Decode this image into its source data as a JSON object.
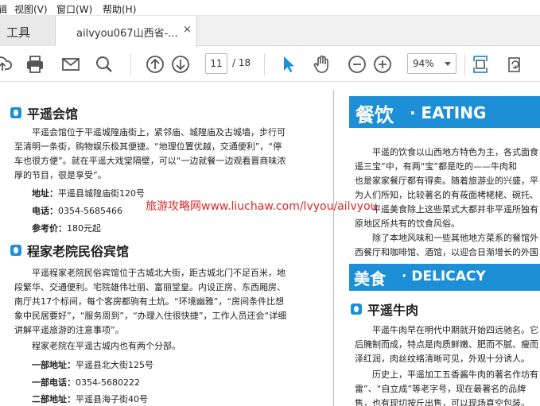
{
  "menu": {
    "partial": "辑",
    "items": [
      "视图(V)",
      "窗口(W)",
      "帮助(H)"
    ]
  },
  "tabs": {
    "tools_label": "工具",
    "doc_title": "ailvyou067山西省-...",
    "close_symbol": "×"
  },
  "toolbar": {
    "page_current": "11",
    "page_total": "/ 18",
    "zoom": "94%",
    "accent": "#1c8fd6"
  },
  "left": {
    "s1_title": "平遥会馆",
    "s1_p1": "平遥会馆位于平遥城隍庙街上，紧邻庙、城隍庙及古城墙，步行可至清明一条街，购物娱乐极其便捷。“地理位置优越，交通便利”，“停车也很方便”。就在平遥大戏堂隔壁，可以“一边就餐一边观看晋商味浓厚的节目，很是享受”。",
    "s1_addr_label": "地址：",
    "s1_addr": "平遥县城隍庙街120号",
    "s1_tel_label": "电话：",
    "s1_tel": "0354-5685466",
    "s1_price_label": "参考价：",
    "s1_price": "180元起",
    "s2_title": "程家老院民俗宾馆",
    "s2_p1": "平遥程家老院民俗宾馆位于古城北大街，距古城北门不足百米，地段繁华、交通便利。宅院雄伟壮丽、富丽堂皇。内设正房、东西厢房、南厅共17个标间，每个客房都驹有土炕。“环境幽雅”，“房间条件比想象中民居要好”，“服务周到”，“办理入住很快捷”，工作人员还会“详细讲解平遥旅游的注意事项”。",
    "s2_p2": "程家老院在平遥古城内也有两个分部。",
    "s2_a1_label": "一部地址：",
    "s2_a1": "平遥县北大街125号",
    "s2_t1_label": "一部电话：",
    "s2_t1": "0354-5680222",
    "s2_a2_label": "二部地址：",
    "s2_a2": "平遥县海子街40号"
  },
  "right": {
    "banner1_cn": "餐饮",
    "banner1_en": "· EATING",
    "p1_lines": [
      "平遥的饮食以山西地方特色为主，各式面食",
      "遥三宝”中，有两“宝”都是吃的——牛肉和",
      "也是家家餐厅都有得卖。随着旅游业的兴盛，平",
      "为人们所知，比较著名的有莜面栲栳栳、碗托、",
      "平遥美食除上这些菜式大都并非平遥所独有",
      "原地区所共有的饮食风俗。"
    ],
    "p2_lines": [
      "除了本地风味和一些其他地方菜系的餐馆外",
      "西餐厅和咖啡馆、酒馆，以迎合日渐增长的外国"
    ],
    "banner2_cn": "美食",
    "banner2_en": "· DELICACY",
    "s3_title": "平遥牛肉",
    "p3_lines": [
      "平遥牛肉早在明代中期就开始四远驰名。它",
      "后腌制而成，特点是肉质鲜嫩、肥而不腻、瘦而",
      "泽红润，肉丝纹络清晰可见，外观十分诱人。"
    ],
    "p4_lines": [
      "历史上，平遥加工五香酱牛肉的著名作坊有",
      "雷”、“自立成”等老字号，现在最著名的品牌",
      "售，也有现切按斤出售，可以现场真空包装。"
    ]
  },
  "watermark": "旅游攻略网www.liuchaw.com/lvyou/ailvyou"
}
